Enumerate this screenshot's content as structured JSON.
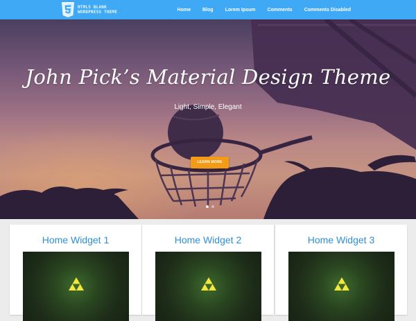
{
  "header": {
    "logo_line1": "HTML5 Blank",
    "logo_line2": "WordPress Theme",
    "nav": [
      "Home",
      "Blog",
      "Lorem Ipsum",
      "Comments",
      "Comments Disabled"
    ]
  },
  "hero": {
    "title": "John Pick’s Material Design Theme",
    "subtitle": "Light, Simple, Elegant",
    "button_label": "LEARN MORE",
    "slides_total": 2,
    "active_slide": 1
  },
  "widgets": [
    {
      "title": "Home Widget 1",
      "image_icon": "triforce-icon"
    },
    {
      "title": "Home Widget 2",
      "image_icon": "triforce-icon"
    },
    {
      "title": "Home Widget 3",
      "image_icon": "triforce-icon"
    }
  ],
  "colors": {
    "nav_bar": "#3fa9f5",
    "button": "#f39a16",
    "widget_title": "#2e8fd8"
  }
}
